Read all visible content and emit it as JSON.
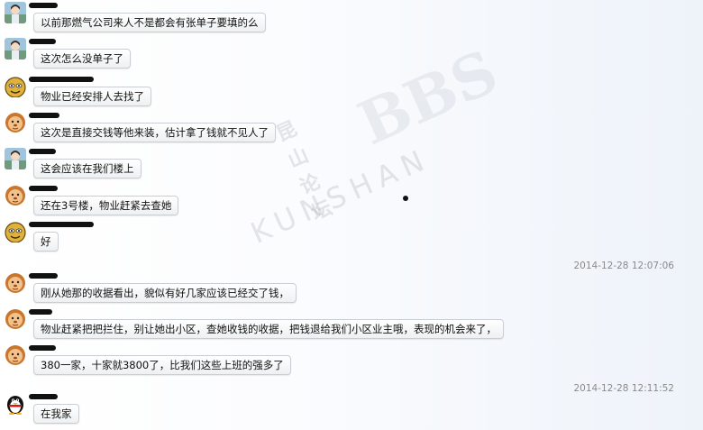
{
  "watermark": {
    "cn": "昆山论坛",
    "en": "KUNSHAN",
    "bbs": "BBS"
  },
  "timestamps": [
    "2014-12-28 12:07:06",
    "2014-12-28 12:11:52"
  ],
  "messages": [
    {
      "avatar": "girl-photo-avatar",
      "text": "以前那燃气公司来人不是都会有张单子要填的么"
    },
    {
      "avatar": "girl-photo-avatar",
      "text": "这次怎么没单子了"
    },
    {
      "avatar": "cartoon-face-avatar",
      "text": "物业已经安排人去找了"
    },
    {
      "avatar": "lion-cartoon-avatar",
      "text": "这次是直接交钱等他来装，估计拿了钱就不见人了"
    },
    {
      "avatar": "girl-photo-avatar",
      "text": "这会应该在我们楼上"
    },
    {
      "avatar": "lion-cartoon-avatar",
      "text": "还在3号楼，物业赶紧去查她"
    },
    {
      "avatar": "cartoon-face-avatar",
      "text": "好"
    },
    {
      "avatar": "lion-cartoon-avatar",
      "text": "刚从她那的收据看出，貌似有好几家应该已经交了钱，"
    },
    {
      "avatar": "lion-cartoon-avatar",
      "text": "物业赶紧把把拦住，别让她出小区，查她收钱的收据，把钱退给我们小区业主哦，表现的机会来了，"
    },
    {
      "avatar": "lion-cartoon-avatar",
      "text": "380一家，十家就3800了，比我们这些上班的强多了"
    },
    {
      "avatar": "penguin-avatar",
      "text": "在我家"
    }
  ]
}
